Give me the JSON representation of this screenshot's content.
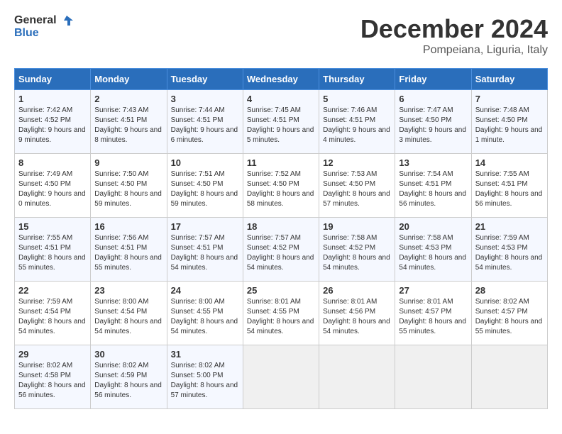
{
  "header": {
    "logo_line1": "General",
    "logo_line2": "Blue",
    "month": "December 2024",
    "location": "Pompeiana, Liguria, Italy"
  },
  "weekdays": [
    "Sunday",
    "Monday",
    "Tuesday",
    "Wednesday",
    "Thursday",
    "Friday",
    "Saturday"
  ],
  "weeks": [
    [
      {
        "day": "1",
        "sunrise": "7:42 AM",
        "sunset": "4:52 PM",
        "daylight": "9 hours and 9 minutes."
      },
      {
        "day": "2",
        "sunrise": "7:43 AM",
        "sunset": "4:51 PM",
        "daylight": "9 hours and 8 minutes."
      },
      {
        "day": "3",
        "sunrise": "7:44 AM",
        "sunset": "4:51 PM",
        "daylight": "9 hours and 6 minutes."
      },
      {
        "day": "4",
        "sunrise": "7:45 AM",
        "sunset": "4:51 PM",
        "daylight": "9 hours and 5 minutes."
      },
      {
        "day": "5",
        "sunrise": "7:46 AM",
        "sunset": "4:51 PM",
        "daylight": "9 hours and 4 minutes."
      },
      {
        "day": "6",
        "sunrise": "7:47 AM",
        "sunset": "4:50 PM",
        "daylight": "9 hours and 3 minutes."
      },
      {
        "day": "7",
        "sunrise": "7:48 AM",
        "sunset": "4:50 PM",
        "daylight": "9 hours and 1 minute."
      }
    ],
    [
      {
        "day": "8",
        "sunrise": "7:49 AM",
        "sunset": "4:50 PM",
        "daylight": "9 hours and 0 minutes."
      },
      {
        "day": "9",
        "sunrise": "7:50 AM",
        "sunset": "4:50 PM",
        "daylight": "8 hours and 59 minutes."
      },
      {
        "day": "10",
        "sunrise": "7:51 AM",
        "sunset": "4:50 PM",
        "daylight": "8 hours and 59 minutes."
      },
      {
        "day": "11",
        "sunrise": "7:52 AM",
        "sunset": "4:50 PM",
        "daylight": "8 hours and 58 minutes."
      },
      {
        "day": "12",
        "sunrise": "7:53 AM",
        "sunset": "4:50 PM",
        "daylight": "8 hours and 57 minutes."
      },
      {
        "day": "13",
        "sunrise": "7:54 AM",
        "sunset": "4:51 PM",
        "daylight": "8 hours and 56 minutes."
      },
      {
        "day": "14",
        "sunrise": "7:55 AM",
        "sunset": "4:51 PM",
        "daylight": "8 hours and 56 minutes."
      }
    ],
    [
      {
        "day": "15",
        "sunrise": "7:55 AM",
        "sunset": "4:51 PM",
        "daylight": "8 hours and 55 minutes."
      },
      {
        "day": "16",
        "sunrise": "7:56 AM",
        "sunset": "4:51 PM",
        "daylight": "8 hours and 55 minutes."
      },
      {
        "day": "17",
        "sunrise": "7:57 AM",
        "sunset": "4:51 PM",
        "daylight": "8 hours and 54 minutes."
      },
      {
        "day": "18",
        "sunrise": "7:57 AM",
        "sunset": "4:52 PM",
        "daylight": "8 hours and 54 minutes."
      },
      {
        "day": "19",
        "sunrise": "7:58 AM",
        "sunset": "4:52 PM",
        "daylight": "8 hours and 54 minutes."
      },
      {
        "day": "20",
        "sunrise": "7:58 AM",
        "sunset": "4:53 PM",
        "daylight": "8 hours and 54 minutes."
      },
      {
        "day": "21",
        "sunrise": "7:59 AM",
        "sunset": "4:53 PM",
        "daylight": "8 hours and 54 minutes."
      }
    ],
    [
      {
        "day": "22",
        "sunrise": "7:59 AM",
        "sunset": "4:54 PM",
        "daylight": "8 hours and 54 minutes."
      },
      {
        "day": "23",
        "sunrise": "8:00 AM",
        "sunset": "4:54 PM",
        "daylight": "8 hours and 54 minutes."
      },
      {
        "day": "24",
        "sunrise": "8:00 AM",
        "sunset": "4:55 PM",
        "daylight": "8 hours and 54 minutes."
      },
      {
        "day": "25",
        "sunrise": "8:01 AM",
        "sunset": "4:55 PM",
        "daylight": "8 hours and 54 minutes."
      },
      {
        "day": "26",
        "sunrise": "8:01 AM",
        "sunset": "4:56 PM",
        "daylight": "8 hours and 54 minutes."
      },
      {
        "day": "27",
        "sunrise": "8:01 AM",
        "sunset": "4:57 PM",
        "daylight": "8 hours and 55 minutes."
      },
      {
        "day": "28",
        "sunrise": "8:02 AM",
        "sunset": "4:57 PM",
        "daylight": "8 hours and 55 minutes."
      }
    ],
    [
      {
        "day": "29",
        "sunrise": "8:02 AM",
        "sunset": "4:58 PM",
        "daylight": "8 hours and 56 minutes."
      },
      {
        "day": "30",
        "sunrise": "8:02 AM",
        "sunset": "4:59 PM",
        "daylight": "8 hours and 56 minutes."
      },
      {
        "day": "31",
        "sunrise": "8:02 AM",
        "sunset": "5:00 PM",
        "daylight": "8 hours and 57 minutes."
      },
      null,
      null,
      null,
      null
    ]
  ]
}
